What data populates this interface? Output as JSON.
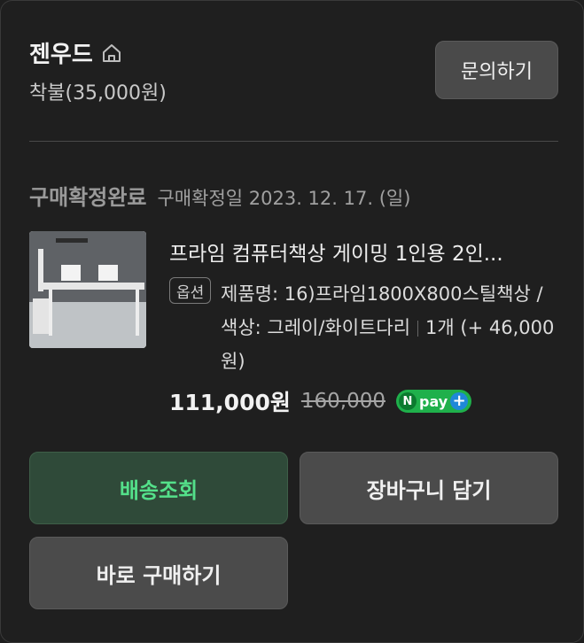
{
  "seller": {
    "name": "젠우드",
    "shipping": "착불(35,000원)",
    "inquiry_label": "문의하기"
  },
  "order": {
    "status": "구매확정완료",
    "confirm_date": "구매확정일 2023. 12. 17. (일)"
  },
  "product": {
    "title": "프라임 컴퓨터책상 게이밍 1인용 2인...",
    "option_badge": "옵션",
    "option_text": "제품명: 16)프라임1800X800스틸책상 / 색상: 그레이/화이트다리",
    "quantity": "1개 (+ 46,000원)",
    "price": "111,000원",
    "original_price": "160,000",
    "npay_label": "pay"
  },
  "buttons": {
    "track": "배송조회",
    "cart": "장바구니 담기",
    "buy": "바로 구매하기"
  },
  "colors": {
    "accent_green": "#54e08a",
    "npay_green": "#1fb04b",
    "npay_blue": "#1f88d8"
  }
}
